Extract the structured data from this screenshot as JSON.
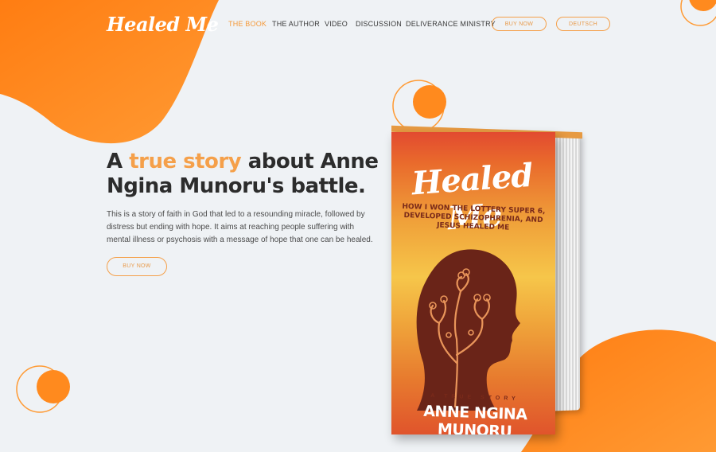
{
  "brand": {
    "logo_text": "Healed Me"
  },
  "nav": {
    "items": [
      {
        "label": "THE BOOK",
        "active": true
      },
      {
        "label": "THE AUTHOR",
        "active": false
      },
      {
        "label": "VIDEO",
        "active": false
      },
      {
        "label": "DISCUSSION",
        "active": false
      },
      {
        "label": "DELIVERANCE MINISTRY",
        "active": false
      }
    ],
    "buy_now_label": "BUY NOW",
    "language_label": "DEUTSCH"
  },
  "hero": {
    "headline_prefix": "A ",
    "headline_accent": "true story",
    "headline_suffix": " about Anne Ngina Munoru's battle.",
    "description": "This is a story of faith in God that led to a resounding miracle, followed by distress but ending with hope. It aims at reaching people suffering with mental illness or psychosis with a message of hope that one can be healed.",
    "cta_label": "BUY NOW"
  },
  "book": {
    "title": "Healed Me",
    "subtitle": "How I won the lottery Super 6, developed schizophrenia, and Jesus healed me",
    "tagline": "A TRUE STORY",
    "author": "ANNE NGINA MUNORU"
  },
  "colors": {
    "accent": "#f5a04a",
    "brand_orange": "#ff8a1e",
    "background": "#eff2f5",
    "text_dark": "#2c2c2c"
  }
}
